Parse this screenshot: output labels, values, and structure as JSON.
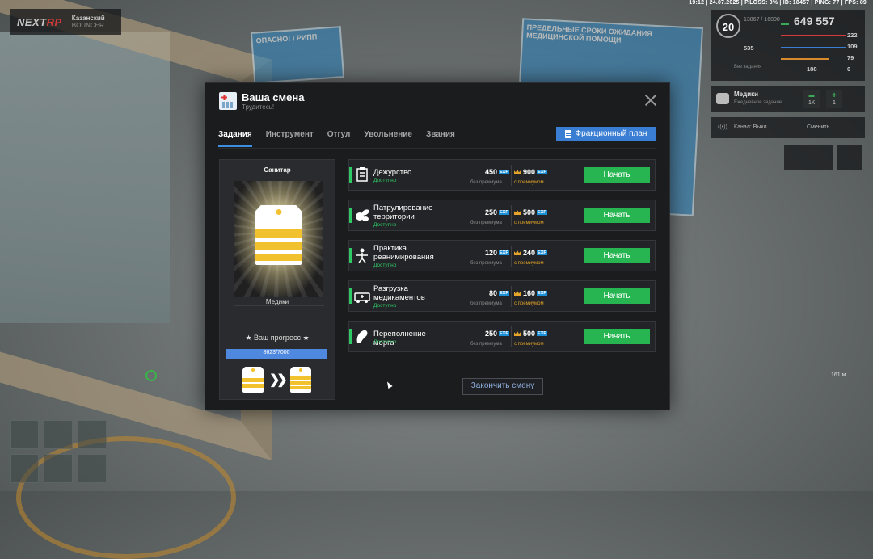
{
  "hud": {
    "topbar": "19:12 | 24.07.2025 | P.LOSS: 0% | ID: 18457 | PING: 77 | FPS: 89",
    "brand_a": "NEXT",
    "brand_b": "RP",
    "server_name": "Казанский",
    "server_sub": "BOUNCER",
    "level": "20",
    "level_xp": "13867 / 16800",
    "money": "649 557",
    "stat_health": "222",
    "stat_armor": "109",
    "stat_hunger": "79",
    "stat_extra": "0",
    "stat_speed": "535",
    "stat_left_bottom": "188",
    "heart_label": "Без задания",
    "faction_name": "Медики",
    "faction_status": "Ежедневное задание",
    "faction_count_a": "1К",
    "faction_count_b": "1",
    "radio_channel": "Канал: Выкл.",
    "radio_change": "Сменить",
    "distance": "161 м"
  },
  "modal": {
    "title": "Ваша смена",
    "subtitle": "Трудитесь!",
    "tabs": [
      "Задания",
      "Инструмент",
      "Отгул",
      "Увольнение",
      "Звания"
    ],
    "plan_button": "Фракционный план",
    "rank": {
      "name": "Санитар",
      "faction": "Медики",
      "progress_label": "★ Ваш прогресс ★",
      "progress_text": "8623/7000",
      "progress_fraction": 1.0
    },
    "end_button": "Закончить смену",
    "reward_basic_label": "без премиума",
    "reward_premium_label": "с премиумом",
    "exp_badge": "EXP",
    "start_label": "Начать",
    "status_label": "Доступно",
    "tasks": [
      {
        "name": "Дежурство",
        "basic": "450",
        "premium": "900",
        "icon": "clipboard-icon"
      },
      {
        "name": "Патрулирование территории",
        "basic": "250",
        "premium": "500",
        "icon": "pills-icon"
      },
      {
        "name": "Практика реанимирования",
        "basic": "120",
        "premium": "240",
        "icon": "resuscitation-icon"
      },
      {
        "name": "Разгрузка медикаментов",
        "basic": "80",
        "premium": "160",
        "icon": "ambulance-icon"
      },
      {
        "name": "Переполнение морга",
        "basic": "250",
        "premium": "500",
        "icon": "morgue-icon"
      }
    ]
  },
  "colors": {
    "accent": "#3a7ed3",
    "start": "#27b552",
    "status": "#2ec866",
    "exp": "#1b8fd6",
    "rank_gold": "#f2c12e"
  }
}
